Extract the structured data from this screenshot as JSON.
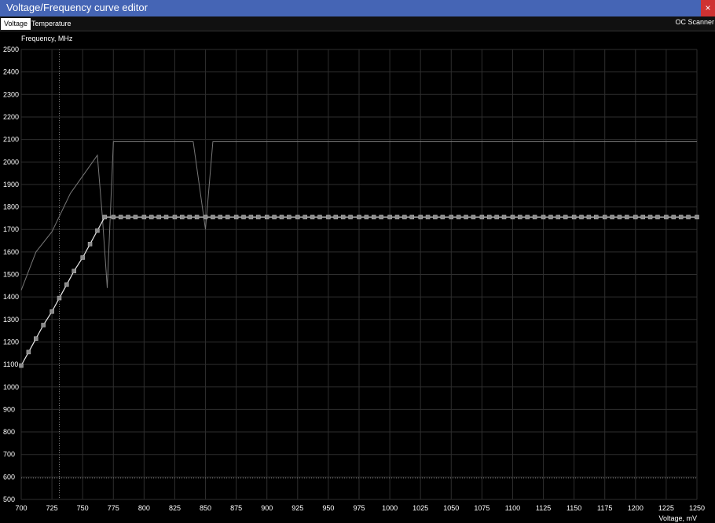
{
  "window": {
    "title": "Voltage/Frequency curve editor",
    "close_glyph": "×"
  },
  "tabs": [
    {
      "label": "Voltage",
      "active": true
    },
    {
      "label": "Temperature",
      "active": false
    }
  ],
  "oc_scanner": {
    "label": "OC Scanner"
  },
  "colors": {
    "titlebar": "#4565b5",
    "close": "#cf3232",
    "grid": "#2e2e2e",
    "curve": "#e8e8e8",
    "point": "#8a8a8a",
    "background_curve": "#777777"
  },
  "chart_data": {
    "type": "line",
    "ylabel": "Frequency, MHz",
    "xlabel": "Voltage, mV",
    "xlim": [
      700,
      1250
    ],
    "ylim": [
      500,
      2500
    ],
    "x_ticks": [
      700,
      725,
      750,
      775,
      800,
      825,
      850,
      875,
      900,
      925,
      950,
      975,
      1000,
      1025,
      1050,
      1075,
      1100,
      1125,
      1150,
      1175,
      1200,
      1225,
      1250
    ],
    "y_ticks": [
      500,
      600,
      700,
      800,
      900,
      1000,
      1100,
      1200,
      1300,
      1400,
      1500,
      1600,
      1700,
      1800,
      1900,
      2000,
      2100,
      2200,
      2300,
      2400,
      2500
    ],
    "grid": true,
    "current_voltage_marker": 731,
    "current_frequency_marker": 595,
    "series": [
      {
        "points": [
          [
            700,
            1095
          ],
          [
            706,
            1155
          ],
          [
            712,
            1215
          ],
          [
            718,
            1275
          ],
          [
            725,
            1335
          ],
          [
            731,
            1395
          ],
          [
            737,
            1455
          ],
          [
            743,
            1515
          ],
          [
            750,
            1575
          ],
          [
            756,
            1635
          ],
          [
            762,
            1695
          ],
          [
            768,
            1755
          ],
          [
            775,
            1755
          ],
          [
            781,
            1755
          ],
          [
            787,
            1755
          ],
          [
            793,
            1755
          ],
          [
            800,
            1755
          ],
          [
            806,
            1755
          ],
          [
            812,
            1755
          ],
          [
            818,
            1755
          ],
          [
            825,
            1755
          ],
          [
            831,
            1755
          ],
          [
            837,
            1755
          ],
          [
            843,
            1755
          ],
          [
            850,
            1755
          ],
          [
            856,
            1755
          ],
          [
            862,
            1755
          ],
          [
            868,
            1755
          ],
          [
            875,
            1755
          ],
          [
            881,
            1755
          ],
          [
            887,
            1755
          ],
          [
            893,
            1755
          ],
          [
            900,
            1755
          ],
          [
            906,
            1755
          ],
          [
            912,
            1755
          ],
          [
            918,
            1755
          ],
          [
            925,
            1755
          ],
          [
            931,
            1755
          ],
          [
            937,
            1755
          ],
          [
            943,
            1755
          ],
          [
            950,
            1755
          ],
          [
            956,
            1755
          ],
          [
            962,
            1755
          ],
          [
            968,
            1755
          ],
          [
            975,
            1755
          ],
          [
            981,
            1755
          ],
          [
            987,
            1755
          ],
          [
            993,
            1755
          ],
          [
            1000,
            1755
          ],
          [
            1006,
            1755
          ],
          [
            1012,
            1755
          ],
          [
            1018,
            1755
          ],
          [
            1025,
            1755
          ],
          [
            1031,
            1755
          ],
          [
            1037,
            1755
          ],
          [
            1043,
            1755
          ],
          [
            1050,
            1755
          ],
          [
            1056,
            1755
          ],
          [
            1062,
            1755
          ],
          [
            1068,
            1755
          ],
          [
            1075,
            1755
          ],
          [
            1081,
            1755
          ],
          [
            1087,
            1755
          ],
          [
            1093,
            1755
          ],
          [
            1100,
            1755
          ],
          [
            1106,
            1755
          ],
          [
            1112,
            1755
          ],
          [
            1118,
            1755
          ],
          [
            1125,
            1755
          ],
          [
            1131,
            1755
          ],
          [
            1137,
            1755
          ],
          [
            1143,
            1755
          ],
          [
            1150,
            1755
          ],
          [
            1156,
            1755
          ],
          [
            1162,
            1755
          ],
          [
            1168,
            1755
          ],
          [
            1175,
            1755
          ],
          [
            1181,
            1755
          ],
          [
            1187,
            1755
          ],
          [
            1193,
            1755
          ],
          [
            1200,
            1755
          ],
          [
            1206,
            1755
          ],
          [
            1212,
            1755
          ],
          [
            1218,
            1755
          ],
          [
            1225,
            1755
          ],
          [
            1231,
            1755
          ],
          [
            1237,
            1755
          ],
          [
            1243,
            1755
          ],
          [
            1250,
            1755
          ]
        ]
      },
      {
        "points": [
          [
            700,
            1430
          ],
          [
            712,
            1600
          ],
          [
            725,
            1690
          ],
          [
            740,
            1860
          ],
          [
            762,
            2030
          ],
          [
            766,
            1760
          ],
          [
            770,
            1440
          ],
          [
            775,
            2090
          ],
          [
            840,
            2090
          ],
          [
            850,
            1700
          ],
          [
            856,
            2090
          ],
          [
            1250,
            2090
          ]
        ]
      }
    ]
  }
}
